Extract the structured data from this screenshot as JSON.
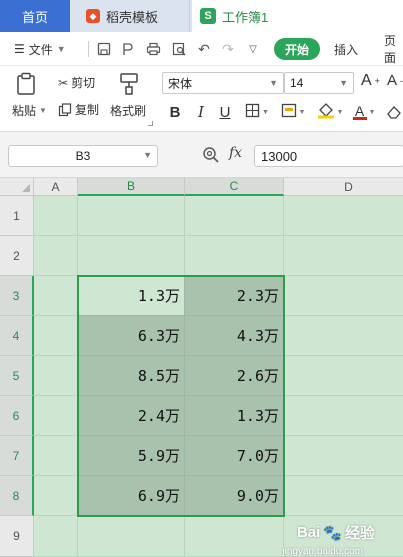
{
  "tabs": {
    "home": "首页",
    "templates": "稻壳模板",
    "workbook": "工作簿1",
    "workbook_icon_letter": "S"
  },
  "menu": {
    "file": "文件",
    "start": "开始",
    "insert": "插入",
    "page": "页面"
  },
  "ribbon": {
    "paste": "粘贴",
    "cut": "剪切",
    "copy": "复制",
    "format_painter": "格式刷",
    "font_name": "宋体",
    "font_size": "14",
    "bold": "B",
    "italic": "I",
    "underline": "U"
  },
  "formula_bar": {
    "name_box": "B3",
    "fx": "fx",
    "value": "13000"
  },
  "sheet": {
    "columns": [
      "A",
      "B",
      "C",
      "D"
    ],
    "rows": [
      "1",
      "2",
      "3",
      "4",
      "5",
      "6",
      "7",
      "8",
      "9"
    ],
    "cells": {
      "B3": "1.3万",
      "C3": "2.3万",
      "B4": "6.3万",
      "C4": "4.3万",
      "B5": "8.5万",
      "C5": "2.6万",
      "B6": "2.4万",
      "C6": "1.3万",
      "B7": "5.9万",
      "C7": "7.0万",
      "B8": "6.9万",
      "C8": "9.0万"
    }
  },
  "watermark": {
    "brand": "Bai",
    "brand2": "经验",
    "url": "jingyan.baidu.com"
  },
  "colors": {
    "accent": "#2aa55a",
    "tab_home": "#3b6fd1",
    "sheet_bg": "#cfe6d3",
    "range_fill": "#a9c2ad"
  }
}
